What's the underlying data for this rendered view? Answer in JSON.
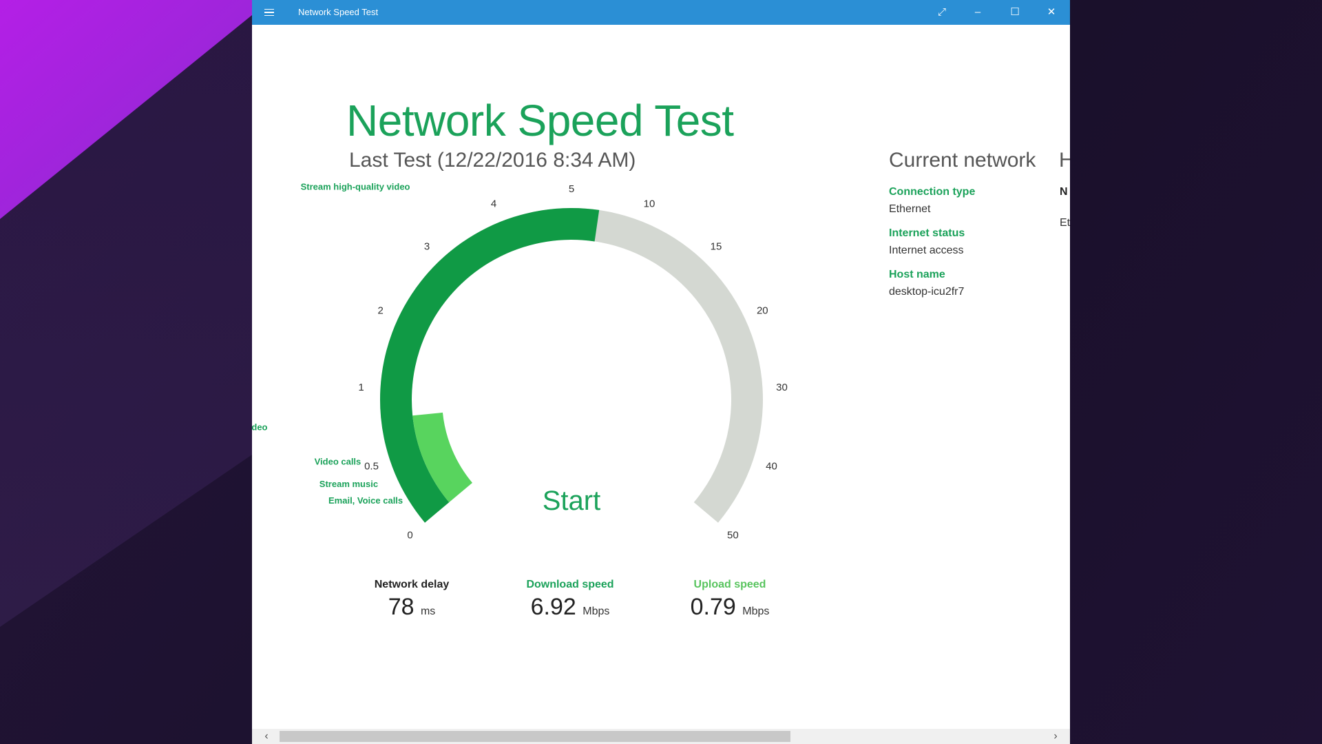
{
  "window": {
    "title": "Network Speed Test",
    "controls": {
      "fullscreen": "⤢",
      "minimize": "–",
      "maximize": "☐",
      "close": "✕"
    },
    "titlebar_color": "#2b8fd5"
  },
  "main": {
    "heading": "Network Speed Test",
    "last_test": "Last Test (12/22/2016 8:34 AM)",
    "start_label": "Start"
  },
  "gauge": {
    "ticks": [
      {
        "label": "0",
        "value": 0
      },
      {
        "label": "0.5",
        "value": 0.5
      },
      {
        "label": "1",
        "value": 1
      },
      {
        "label": "2",
        "value": 2
      },
      {
        "label": "3",
        "value": 3
      },
      {
        "label": "4",
        "value": 4
      },
      {
        "label": "5",
        "value": 5
      },
      {
        "label": "10",
        "value": 10
      },
      {
        "label": "15",
        "value": 15
      },
      {
        "label": "20",
        "value": 20
      },
      {
        "label": "30",
        "value": 30
      },
      {
        "label": "40",
        "value": 40
      },
      {
        "label": "50",
        "value": 50
      }
    ],
    "activities": [
      "Stream high-quality video",
      "Stream low-quality video",
      "Video calls",
      "Stream music",
      "Email, Voice calls"
    ],
    "download_mbps": 6.92,
    "upload_mbps": 0.79,
    "colors": {
      "track": "#d4d8d2",
      "download": "#109a45",
      "upload": "#58d45e",
      "text_green": "#1ba25a"
    }
  },
  "stats": {
    "delay": {
      "label": "Network delay",
      "value": "78",
      "unit": "ms",
      "color": "#222222"
    },
    "download": {
      "label": "Download speed",
      "value": "6.92",
      "unit": "Mbps",
      "color": "#1ba25a"
    },
    "upload": {
      "label": "Upload speed",
      "value": "0.79",
      "unit": "Mbps",
      "color": "#58c45e"
    }
  },
  "network": {
    "title": "Current network",
    "title_cut": "H",
    "items": [
      {
        "label": "Connection type",
        "value": "Ethernet"
      },
      {
        "label": "Internet status",
        "value": "Internet access"
      },
      {
        "label": "Host name",
        "value": "desktop-icu2fr7"
      }
    ],
    "cut_label": "N",
    "cut_value": "Et"
  },
  "scrollbar": {
    "left_arrow": "‹",
    "right_arrow": "›"
  }
}
